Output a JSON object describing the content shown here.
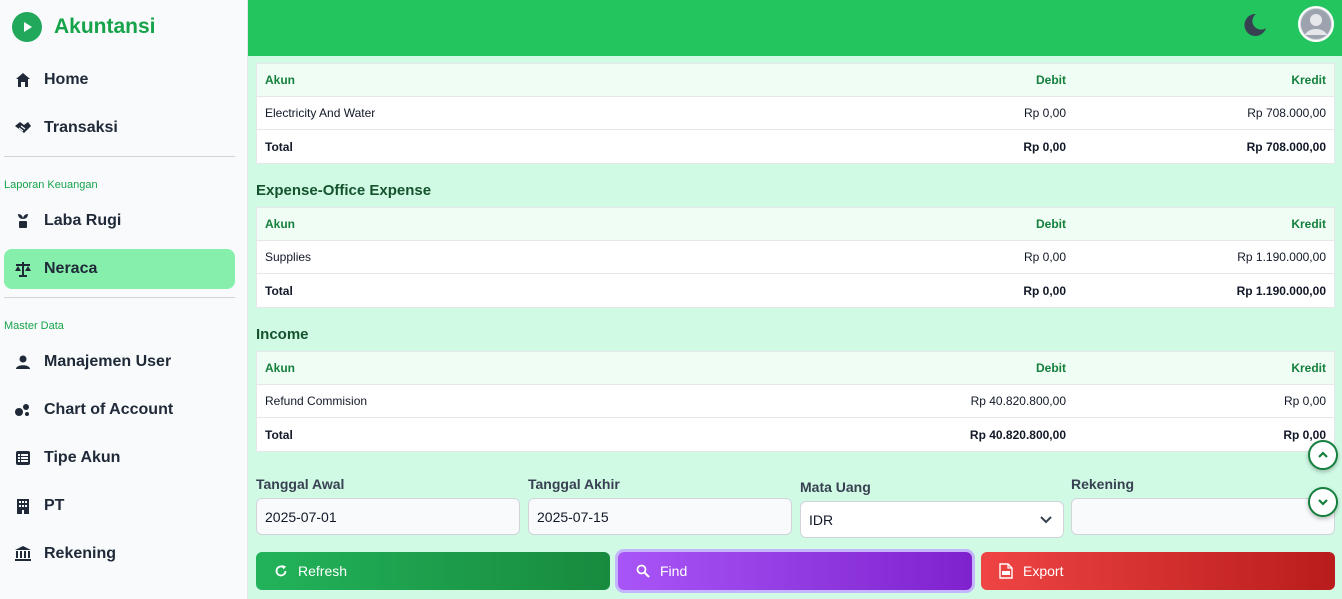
{
  "app": {
    "name": "Akuntansi",
    "accent": "#22c55e"
  },
  "sidebar": {
    "items_top": [
      {
        "label": "Home",
        "icon": "home-icon"
      },
      {
        "label": "Transaksi",
        "icon": "handshake-icon"
      }
    ],
    "section_reports": "Laporan Keuangan",
    "items_reports": [
      {
        "label": "Laba Rugi",
        "icon": "plant-icon"
      },
      {
        "label": "Neraca",
        "icon": "scale-icon",
        "active": true
      }
    ],
    "section_master": "Master Data",
    "items_master": [
      {
        "label": "Manajemen User",
        "icon": "user-icon"
      },
      {
        "label": "Chart of Account",
        "icon": "circles-icon"
      },
      {
        "label": "Tipe Akun",
        "icon": "list-icon"
      },
      {
        "label": "PT",
        "icon": "building-icon"
      },
      {
        "label": "Rekening",
        "icon": "bank-icon"
      }
    ]
  },
  "header": {
    "theme_icon": "moon-icon",
    "avatar_icon": "user-avatar-icon"
  },
  "tables": [
    {
      "title": "",
      "headers": {
        "akun": "Akun",
        "debit": "Debit",
        "kredit": "Kredit"
      },
      "rows": [
        {
          "akun": "Electricity And Water",
          "debit": "Rp 0,00",
          "kredit": "Rp 708.000,00"
        }
      ],
      "total": {
        "label": "Total",
        "debit": "Rp 0,00",
        "kredit": "Rp 708.000,00"
      }
    },
    {
      "title": "Expense-Office Expense",
      "headers": {
        "akun": "Akun",
        "debit": "Debit",
        "kredit": "Kredit"
      },
      "rows": [
        {
          "akun": "Supplies",
          "debit": "Rp 0,00",
          "kredit": "Rp 1.190.000,00"
        }
      ],
      "total": {
        "label": "Total",
        "debit": "Rp 0,00",
        "kredit": "Rp 1.190.000,00"
      }
    },
    {
      "title": "Income",
      "headers": {
        "akun": "Akun",
        "debit": "Debit",
        "kredit": "Kredit"
      },
      "rows": [
        {
          "akun": "Refund Commision",
          "debit": "Rp 40.820.800,00",
          "kredit": "Rp 0,00"
        }
      ],
      "total": {
        "label": "Total",
        "debit": "Rp 40.820.800,00",
        "kredit": "Rp 0,00"
      }
    }
  ],
  "filters": {
    "tanggal_awal": {
      "label": "Tanggal Awal",
      "value": "2025-07-01"
    },
    "tanggal_akhir": {
      "label": "Tanggal Akhir",
      "value": "2025-07-15"
    },
    "mata_uang": {
      "label": "Mata Uang",
      "value": "IDR"
    },
    "rekening": {
      "label": "Rekening",
      "value": ""
    }
  },
  "buttons": {
    "refresh": "Refresh",
    "find": "Find",
    "export": "Export"
  },
  "colors": {
    "refresh": "#16a34a",
    "find": "#9333ea",
    "export": "#dc2626"
  }
}
